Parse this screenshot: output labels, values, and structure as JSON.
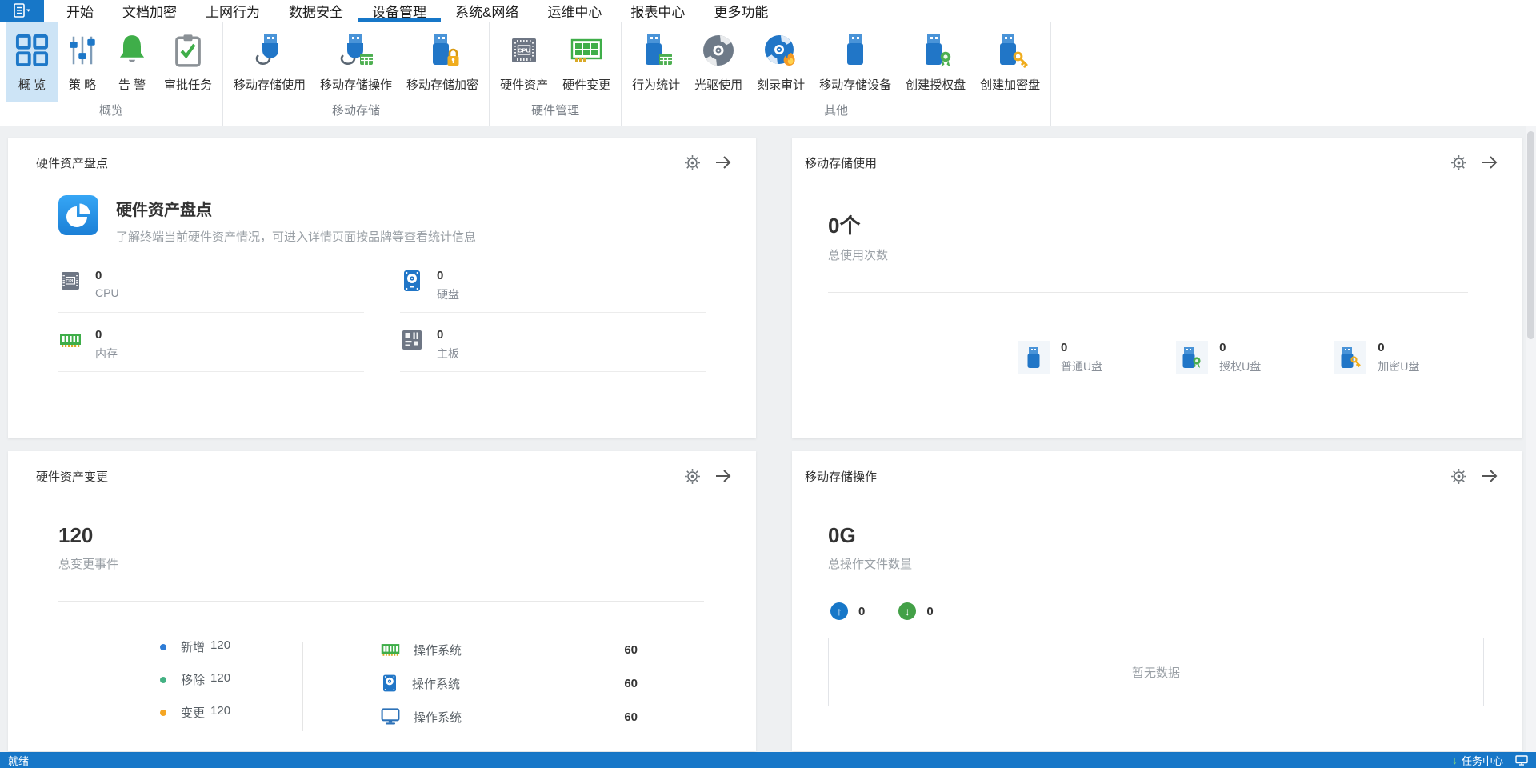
{
  "colors": {
    "primary_blue": "#1777c8",
    "selected_button_bg": "#cde4f6",
    "legend_blue": "#2e7cd6",
    "legend_green": "#43b183",
    "legend_orange": "#f5a623"
  },
  "menu": {
    "tabs": [
      "开始",
      "文档加密",
      "上网行为",
      "数据安全",
      "设备管理",
      "系统&网络",
      "运维中心",
      "报表中心",
      "更多功能"
    ],
    "active_tab": "设备管理"
  },
  "ribbon": {
    "groups": [
      {
        "label": "概览",
        "buttons": [
          {
            "label": "概 览",
            "icon": "overview-grid"
          },
          {
            "label": "策 略",
            "icon": "sliders"
          },
          {
            "label": "告 警",
            "icon": "bell"
          },
          {
            "label": "审批任务",
            "icon": "clipboard-check"
          }
        ]
      },
      {
        "label": "移动存储",
        "buttons": [
          {
            "label": "移动存储使用",
            "icon": "usb-plug"
          },
          {
            "label": "移动存储操作",
            "icon": "usb-plug-table"
          },
          {
            "label": "移动存储加密",
            "icon": "usb-lock"
          }
        ]
      },
      {
        "label": "硬件管理",
        "buttons": [
          {
            "label": "硬件资产",
            "icon": "cpu-chip"
          },
          {
            "label": "硬件变更",
            "icon": "ram-card"
          }
        ]
      },
      {
        "label": "其他",
        "buttons": [
          {
            "label": "行为统计",
            "icon": "usb-table"
          },
          {
            "label": "光驱使用",
            "icon": "cd"
          },
          {
            "label": "刻录审计",
            "icon": "cd-burn"
          },
          {
            "label": "移动存储设备",
            "icon": "usb"
          },
          {
            "label": "创建授权盘",
            "icon": "usb-award"
          },
          {
            "label": "创建加密盘",
            "icon": "usb-key"
          }
        ]
      }
    ]
  },
  "cards": {
    "hardware_inventory": {
      "header": "硬件资产盘点",
      "feature_title": "硬件资产盘点",
      "feature_desc": "了解终端当前硬件资产情况，可进入详情页面按品牌等查看统计信息",
      "stats": [
        {
          "label": "CPU",
          "value": "0"
        },
        {
          "label": "硬盘",
          "value": "0"
        },
        {
          "label": "内存",
          "value": "0"
        },
        {
          "label": "主板",
          "value": "0"
        }
      ]
    },
    "storage_usage": {
      "header": "移动存储使用",
      "big_value": "0个",
      "big_label": "总使用次数",
      "stats": [
        {
          "label": "普通U盘",
          "value": "0"
        },
        {
          "label": "授权U盘",
          "value": "0"
        },
        {
          "label": "加密U盘",
          "value": "0"
        }
      ]
    },
    "hardware_change": {
      "header": "硬件资产变更",
      "big_value": "120",
      "big_label": "总变更事件",
      "legend": [
        {
          "label": "新增",
          "value": "120",
          "color": "#2e7cd6"
        },
        {
          "label": "移除",
          "value": "120",
          "color": "#43b183"
        },
        {
          "label": "变更",
          "value": "120",
          "color": "#f5a623"
        }
      ],
      "list": [
        {
          "label": "操作系统",
          "value": "60",
          "icon": "ram"
        },
        {
          "label": "操作系统",
          "value": "60",
          "icon": "hdd"
        },
        {
          "label": "操作系统",
          "value": "60",
          "icon": "monitor"
        }
      ]
    },
    "storage_ops": {
      "header": "移动存储操作",
      "big_value": "0G",
      "big_label": "总操作文件数量",
      "upload_value": "0",
      "download_value": "0",
      "empty_text": "暂无数据"
    }
  },
  "statusbar": {
    "ready_text": "就绪",
    "task_center": "任务中心"
  }
}
